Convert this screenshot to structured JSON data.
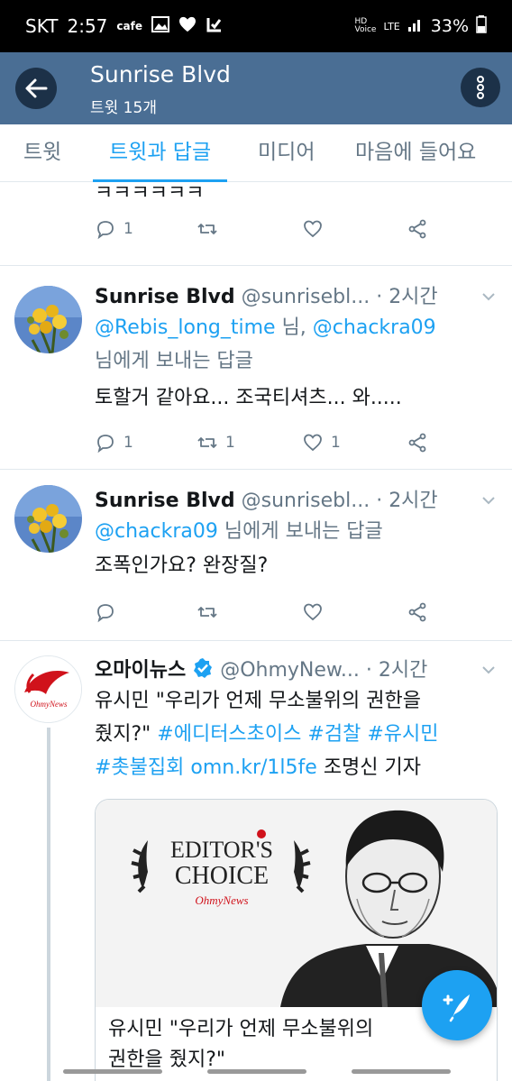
{
  "status": {
    "carrier": "SKT",
    "time": "2:57",
    "cafe": "cafe",
    "hd": "HD",
    "voice": "Voice",
    "lte": "LTE",
    "battery": "33%"
  },
  "header": {
    "title": "Sunrise Blvd",
    "subtitle": "트윗 15개"
  },
  "tabs": [
    {
      "label": "트윗"
    },
    {
      "label": "트윗과 답글"
    },
    {
      "label": "미디어"
    },
    {
      "label": "마음에 들어요"
    }
  ],
  "tweets": [
    {
      "partial_text": "ㅋㅋㅋㅋㅋㅋ",
      "reply_count": "1"
    },
    {
      "name": "Sunrise Blvd",
      "handle": "@sunrisebl...",
      "time": "· 2시간",
      "mention1": "@Rebis_long_time",
      "mention_sep": " 님, ",
      "mention2": "@chackra09",
      "reply_suffix": "님에게 보내는 답글",
      "text": "토할거 같아요... 조국티셔츠... 와.....",
      "reply_count": "1",
      "retweet_count": "1",
      "like_count": "1"
    },
    {
      "name": "Sunrise Blvd",
      "handle": "@sunrisebl...",
      "time": "· 2시간",
      "mention": "@chackra09",
      "reply_suffix": " 님에게 보내는 답글",
      "text": "조폭인가요? 완장질?"
    },
    {
      "name": "오마이뉴스",
      "handle": "@OhmyNew...",
      "time": "· 2시간",
      "text_line1": "유시민 \"우리가 언제 무소불위의 권한을",
      "text_line2_plain": "줬지?\" ",
      "tag1": "#에디터스초이스",
      "tag2": "#검찰",
      "tag3": "#유시민",
      "tag4": "#촛불집회",
      "link": "omn.kr/1l5fe",
      "author": " 조명신 기자",
      "logo_text": "OhmyNews",
      "card_badge1": "EDITOR'S",
      "card_badge2": "CHOICE",
      "card_badge3": "OhmyNews",
      "card_title_line1": "유시민 \"우리가 언제 무소불위의",
      "card_title_line2": "권한을 줬지?\""
    }
  ],
  "colors": {
    "header": "#4a6e94",
    "accent": "#1da1f2",
    "muted": "#657786"
  }
}
